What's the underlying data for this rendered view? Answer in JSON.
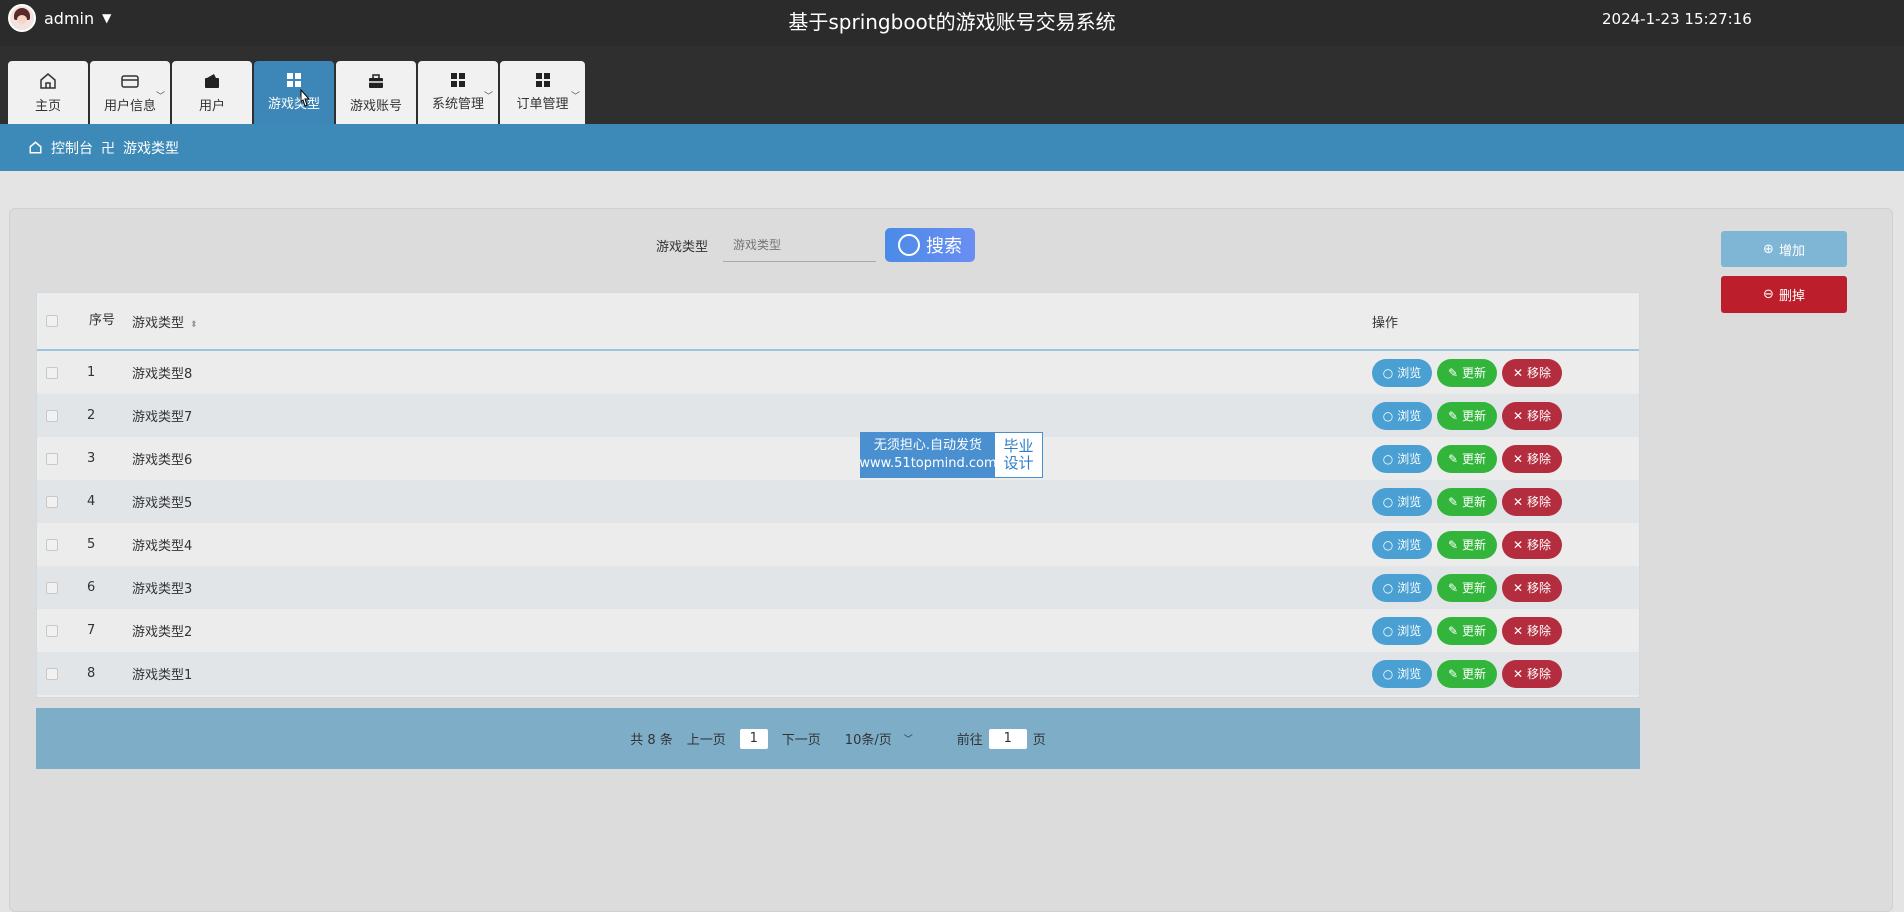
{
  "header": {
    "username": "admin",
    "title": "基于springboot的游戏账号交易系统",
    "datetime": "2024-1-23 15:27:16"
  },
  "nav": [
    {
      "label": "主页",
      "icon": "home-icon"
    },
    {
      "label": "用户信息",
      "icon": "card-icon",
      "has_arrow": true
    },
    {
      "label": "用户",
      "icon": "wallet-icon"
    },
    {
      "label": "游戏类型",
      "icon": "grid-icon",
      "active": true
    },
    {
      "label": "游戏账号",
      "icon": "briefcase-icon"
    },
    {
      "label": "系统管理",
      "icon": "grid-icon",
      "has_arrow": true
    },
    {
      "label": "订单管理",
      "icon": "grid-icon",
      "has_arrow": true
    }
  ],
  "breadcrumb": {
    "root": "控制台",
    "separator": "卍",
    "current": "游戏类型"
  },
  "search": {
    "label": "游戏类型",
    "placeholder": "游戏类型",
    "button": "搜索"
  },
  "actions": {
    "add": "增加",
    "delete": "删掉"
  },
  "table": {
    "headers": {
      "index": "序号",
      "name": "游戏类型",
      "ops": "操作"
    },
    "rows": [
      {
        "index": "1",
        "name": "游戏类型8"
      },
      {
        "index": "2",
        "name": "游戏类型7"
      },
      {
        "index": "3",
        "name": "游戏类型6"
      },
      {
        "index": "4",
        "name": "游戏类型5"
      },
      {
        "index": "5",
        "name": "游戏类型4"
      },
      {
        "index": "6",
        "name": "游戏类型3"
      },
      {
        "index": "7",
        "name": "游戏类型2"
      },
      {
        "index": "8",
        "name": "游戏类型1"
      }
    ],
    "op_labels": {
      "view": "浏览",
      "edit": "更新",
      "remove": "移除"
    }
  },
  "watermark": {
    "line1": "无须担心.自动发货",
    "line2": "www.51topmind.com",
    "right1": "毕业",
    "right2": "设计"
  },
  "pagination": {
    "total": "共 8 条",
    "prev": "上一页",
    "page": "1",
    "next": "下一页",
    "size": "10条/页",
    "goto_prefix": "前往",
    "goto_value": "1",
    "goto_suffix": "页"
  }
}
